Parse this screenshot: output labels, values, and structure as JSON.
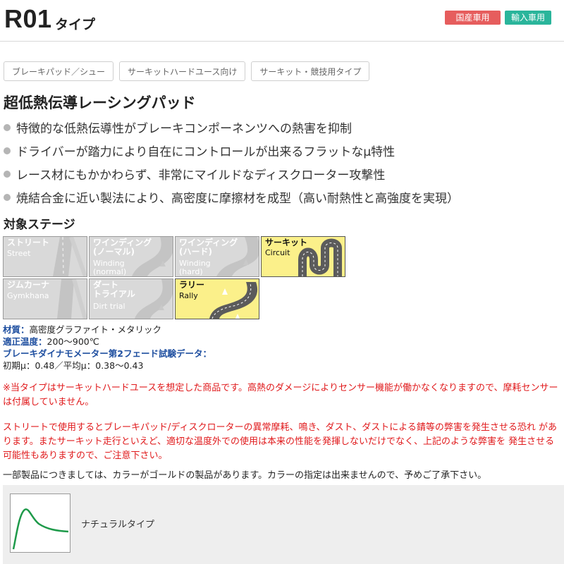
{
  "header": {
    "model": "R01",
    "type_label": "タイプ",
    "badges": [
      {
        "label": "国産車用",
        "color": "#e65d5d"
      },
      {
        "label": "輸入車用",
        "color": "#2ab59b"
      }
    ]
  },
  "tags": [
    "ブレーキパッド／シュー",
    "サーキットハードユース向け",
    "サーキット・競技用タイプ"
  ],
  "headline": "超低熱伝導レーシングパッド",
  "features": [
    "特徴的な低熱伝導性がブレーキコンポーネンツへの熱害を抑制",
    "ドライバーが踏力により自在にコントロールが出来るフラットなμ特性",
    "レース材にもかかわらず、非常にマイルドなディスクローター攻撃性",
    "焼結合金に近い製法により、高密度に摩擦材を成型（高い耐熱性と高強度を実現）"
  ],
  "stage_section": {
    "title": "対象ステージ",
    "stages": [
      {
        "jp": "ストリート",
        "en": "Street",
        "active": false
      },
      {
        "jp": "ワインディング\n(ノーマル)",
        "en": "Winding\n(normal)",
        "active": false
      },
      {
        "jp": "ワインディング\n(ハード)",
        "en": "Winding\n(hard)",
        "active": false
      },
      {
        "jp": "サーキット",
        "en": "Circuit",
        "active": true
      },
      {
        "jp": "ジムカーナ",
        "en": "Gymkhana",
        "active": false
      },
      {
        "jp": "ダート\nトライアル",
        "en": "Dirt trial",
        "active": false
      },
      {
        "jp": "ラリー",
        "en": "Rally",
        "active": true
      }
    ]
  },
  "specs": {
    "material_label": "材質：",
    "material_value": "高密度グラファイト・メタリック",
    "temp_label": "適正温度：",
    "temp_value": "200〜900℃",
    "dyno_label": "ブレーキダイナモメーター第2フェード試験データ：",
    "dyno_value": "初期μ：0.48／平均μ：0.38〜0.43"
  },
  "warnings": [
    "※当タイプはサーキットハードユースを想定した商品です。高熱のダメージによりセンサー機能が働かなくなりますので、摩耗センサーは付属していません。",
    "ストリートで使用するとブレーキパッド/ディスクローターの異常摩耗、鳴き、ダスト、ダストによる錆等の弊害を発生させる恐れ があります。またサーキット走行といえど、適切な温度外での使用は本来の性能を発揮しないだけでなく、上記のような弊害を 発生させる可能性もありますので、ご注意下さい。"
  ],
  "note": "一部製品につきましては、カラーがゴールドの製品があります。カラーの指定は出来ませんので、予めご了承下さい。",
  "curve": {
    "label": "ナチュラルタイプ",
    "color": "#1e9a4a"
  }
}
